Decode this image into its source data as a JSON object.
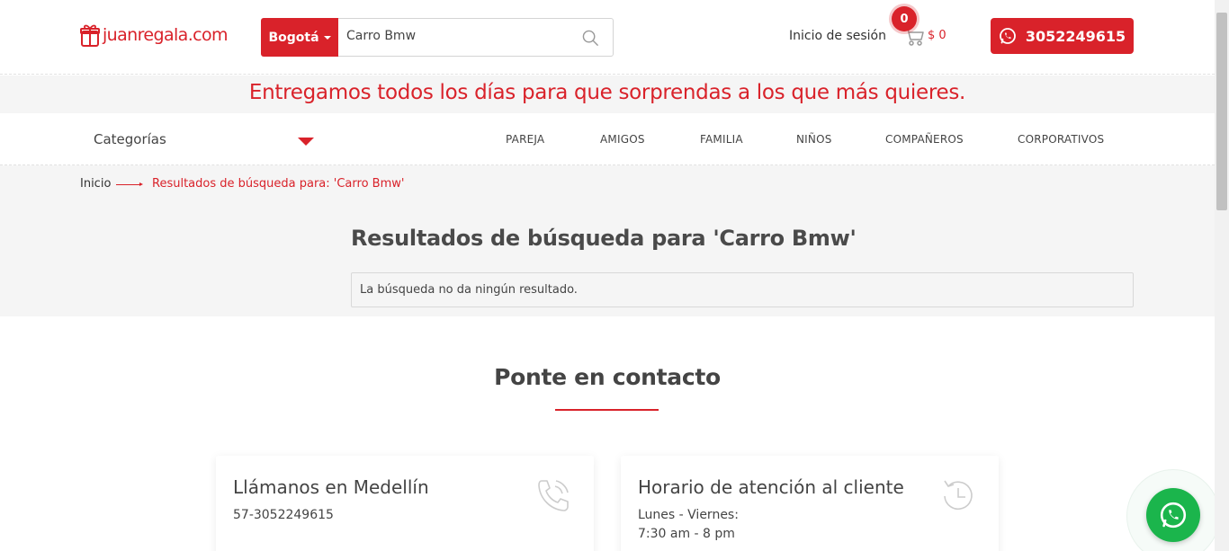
{
  "header": {
    "logo_text": "juanregala.com",
    "city_label": "Bogotá",
    "search_value": "Carro Bmw",
    "login_label": "Inicio de sesión",
    "cart_count": "0",
    "cart_total": "$ 0",
    "whatsapp_number": "3052249615"
  },
  "banner": {
    "text": "Entregamos todos los días para que sorprendas a los que más quieres."
  },
  "nav": {
    "categories_label": "Categorías",
    "links": [
      "PAREJA",
      "AMIGOS",
      "FAMILIA",
      "NIÑOS",
      "COMPAÑEROS",
      "CORPORATIVOS"
    ]
  },
  "breadcrumb": {
    "home": "Inicio",
    "current": "Resultados de búsqueda para: 'Carro Bmw'"
  },
  "results": {
    "title": "Resultados de búsqueda para 'Carro Bmw'",
    "notice": "La búsqueda no da ningún resultado."
  },
  "contact": {
    "title": "Ponte en contacto",
    "cards": [
      {
        "title": "Llámanos en Medellín",
        "lines": [
          "57-3052249615"
        ],
        "icon": "phone-icon"
      },
      {
        "title": "Horario de atención al cliente",
        "lines": [
          "Lunes - Viernes:",
          "7:30 am - 8 pm"
        ],
        "icon": "clock-icon"
      }
    ]
  },
  "colors": {
    "brand_red": "#d9222a",
    "whatsapp_green": "#1bb54c",
    "light_gray_bg": "#f5f5f5"
  }
}
